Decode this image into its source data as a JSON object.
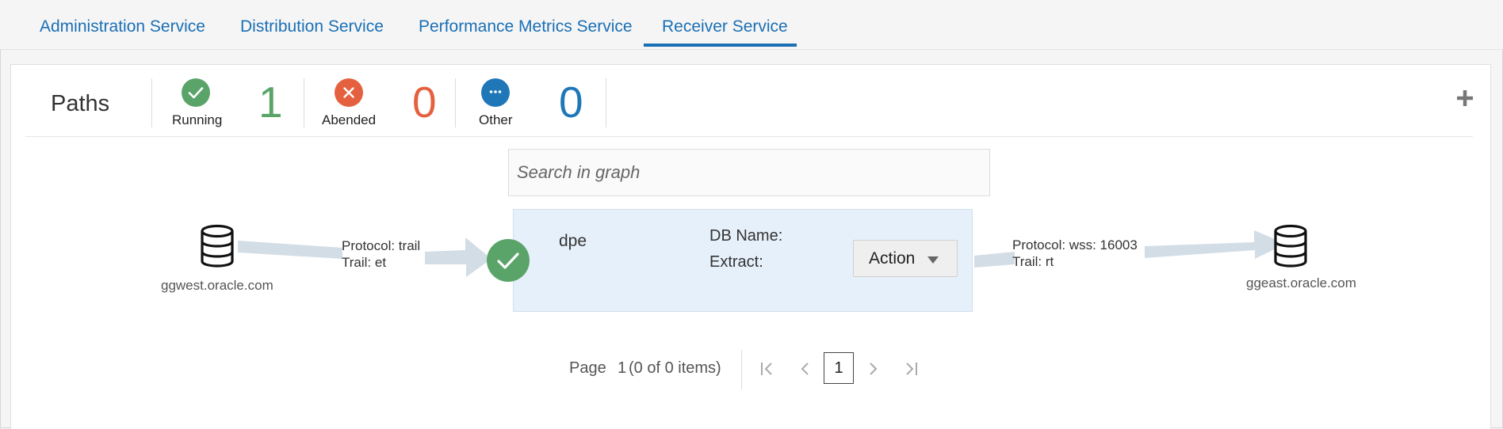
{
  "tabs": [
    {
      "label": "Administration Service"
    },
    {
      "label": "Distribution Service"
    },
    {
      "label": "Performance Metrics Service"
    },
    {
      "label": "Receiver Service",
      "active": true
    }
  ],
  "summary": {
    "title": "Paths",
    "running": {
      "label": "Running",
      "count": "1",
      "color": "#5aa469",
      "icon": "check-icon"
    },
    "abended": {
      "label": "Abended",
      "count": "0",
      "color": "#e5603f",
      "icon": "x-icon"
    },
    "other": {
      "label": "Other",
      "count": "0",
      "color": "#1f77b8",
      "icon": "ellipsis-icon"
    }
  },
  "search": {
    "placeholder": "Search in graph"
  },
  "graph": {
    "source": {
      "host": "ggwest.oracle.com",
      "icon": "database-icon"
    },
    "inbound": {
      "protocol": "Protocol: trail",
      "trail": "Trail: et"
    },
    "path": {
      "name": "dpe",
      "status_icon": "check-icon",
      "db_name_label": "DB Name:",
      "extract_label": "Extract:",
      "action_label": "Action"
    },
    "outbound": {
      "protocol": "Protocol: wss: 16003",
      "trail": "Trail: rt"
    },
    "target": {
      "host": "ggeast.oracle.com",
      "icon": "database-icon"
    }
  },
  "pagination": {
    "page_label": "Page",
    "page_number": "1",
    "items_text": "(0 of 0 items)",
    "current_page": "1"
  },
  "colors": {
    "accent": "#1a6fb5",
    "card_bg": "#e6f0fa",
    "edge": "#d3dde6"
  }
}
